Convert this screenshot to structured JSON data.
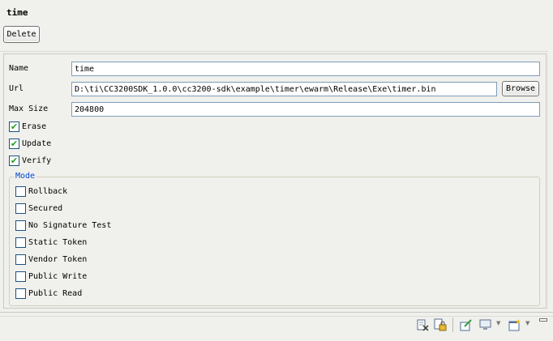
{
  "header": {
    "title": "time",
    "delete_label": "Delete"
  },
  "form": {
    "name_label": "Name",
    "name_value": "time",
    "url_label": "Url",
    "url_value": "D:\\ti\\CC3200SDK_1.0.0\\cc3200-sdk\\example\\timer\\ewarm\\Release\\Exe\\timer.bin",
    "browse_label": "Browse",
    "maxsize_label": "Max Size",
    "maxsize_value": "204800",
    "erase_label": "Erase",
    "erase_checked": true,
    "update_label": "Update",
    "update_checked": true,
    "verify_label": "Verify",
    "verify_checked": true
  },
  "mode": {
    "legend": "Mode",
    "options": [
      {
        "label": "Rollback",
        "checked": false
      },
      {
        "label": "Secured",
        "checked": false
      },
      {
        "label": "No Signature Test",
        "checked": false
      },
      {
        "label": "Static Token",
        "checked": false
      },
      {
        "label": "Vendor Token",
        "checked": false
      },
      {
        "label": "Public Write",
        "checked": false
      },
      {
        "label": "Public Read",
        "checked": false
      }
    ]
  },
  "toolbar": {
    "icons": [
      "remove-icon",
      "lock-icon",
      "edit-icon",
      "monitor-icon",
      "new-window-icon"
    ]
  }
}
